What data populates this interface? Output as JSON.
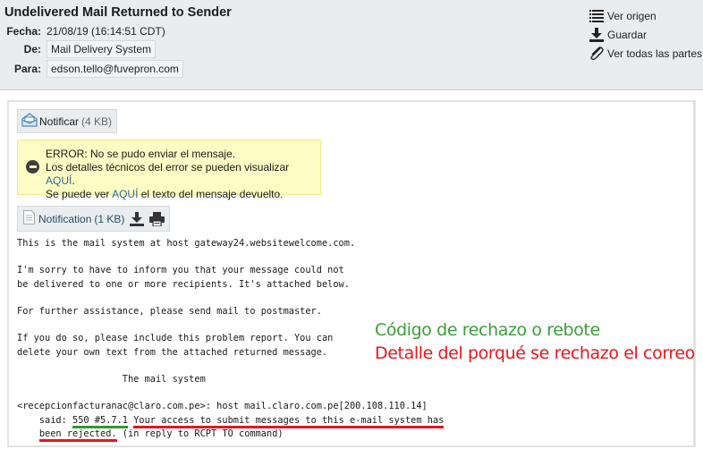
{
  "header": {
    "subject": "Undelivered Mail Returned to Sender",
    "fields": {
      "fecha": {
        "label": "Fecha:",
        "value": "21/08/19 (16:14:51 CDT)"
      },
      "de": {
        "label": "De:",
        "value": "Mail Delivery System"
      },
      "para": {
        "label": "Para:",
        "value": "edson.tello@fuvepron.com"
      }
    },
    "actions": [
      {
        "label": "Ver origen",
        "icon": "list-icon"
      },
      {
        "label": "Guardar",
        "icon": "download-icon"
      },
      {
        "label": "Ver todas las partes",
        "icon": "paperclip-icon"
      }
    ]
  },
  "attachments": {
    "notificar": {
      "name": "Notificar",
      "size": "(4 KB)",
      "icon": "envelope-open-icon"
    },
    "notification": {
      "name": "Notification",
      "size": "(1 KB)",
      "icon": "document-icon"
    }
  },
  "alert": {
    "icon": "minus-circle-icon",
    "line1": "ERROR: No se pudo enviar el mensaje.",
    "line2_prefix": "Los detalles técnicos del error se pueden visualizar ",
    "line2_link": "AQUÍ",
    "line2_suffix": ".",
    "line3_prefix": "Se puede ver ",
    "line3_link": "AQUÍ",
    "line3_suffix": " el texto del mensaje devuelto."
  },
  "message": {
    "line1": "This is the mail system at host gateway24.websitewelcome.com.",
    "line2": "I'm sorry to have to inform you that your message could not",
    "line3": "be delivered to one or more recipients. It's attached below.",
    "line4": "For further assistance, please send mail to postmaster.",
    "line5": "If you do so, please include this problem report. You can",
    "line6": "delete your own text from the attached returned message.",
    "line7": "                   The mail system",
    "line8": "<recepcionfacturanac@claro.com.pe>: host mail.claro.com.pe[200.108.110.14]",
    "said_prefix": "    said: ",
    "code": "550 #5.7.1",
    "detail1": "Your access to submit messages to this e-mail system has",
    "indent": "    ",
    "detail2": "been rejected.",
    "tail": " (in reply to RCPT TO command)"
  },
  "annotations": {
    "green": "Código de rechazo o rebote",
    "red": "Detalle del porqué se rechazo el correo"
  },
  "colors": {
    "header_bg": "#eaedf0",
    "alert_bg": "#fcfcc4",
    "link": "#2e6a9a",
    "annotation_green": "#3aa038",
    "annotation_red": "#f0141c"
  }
}
